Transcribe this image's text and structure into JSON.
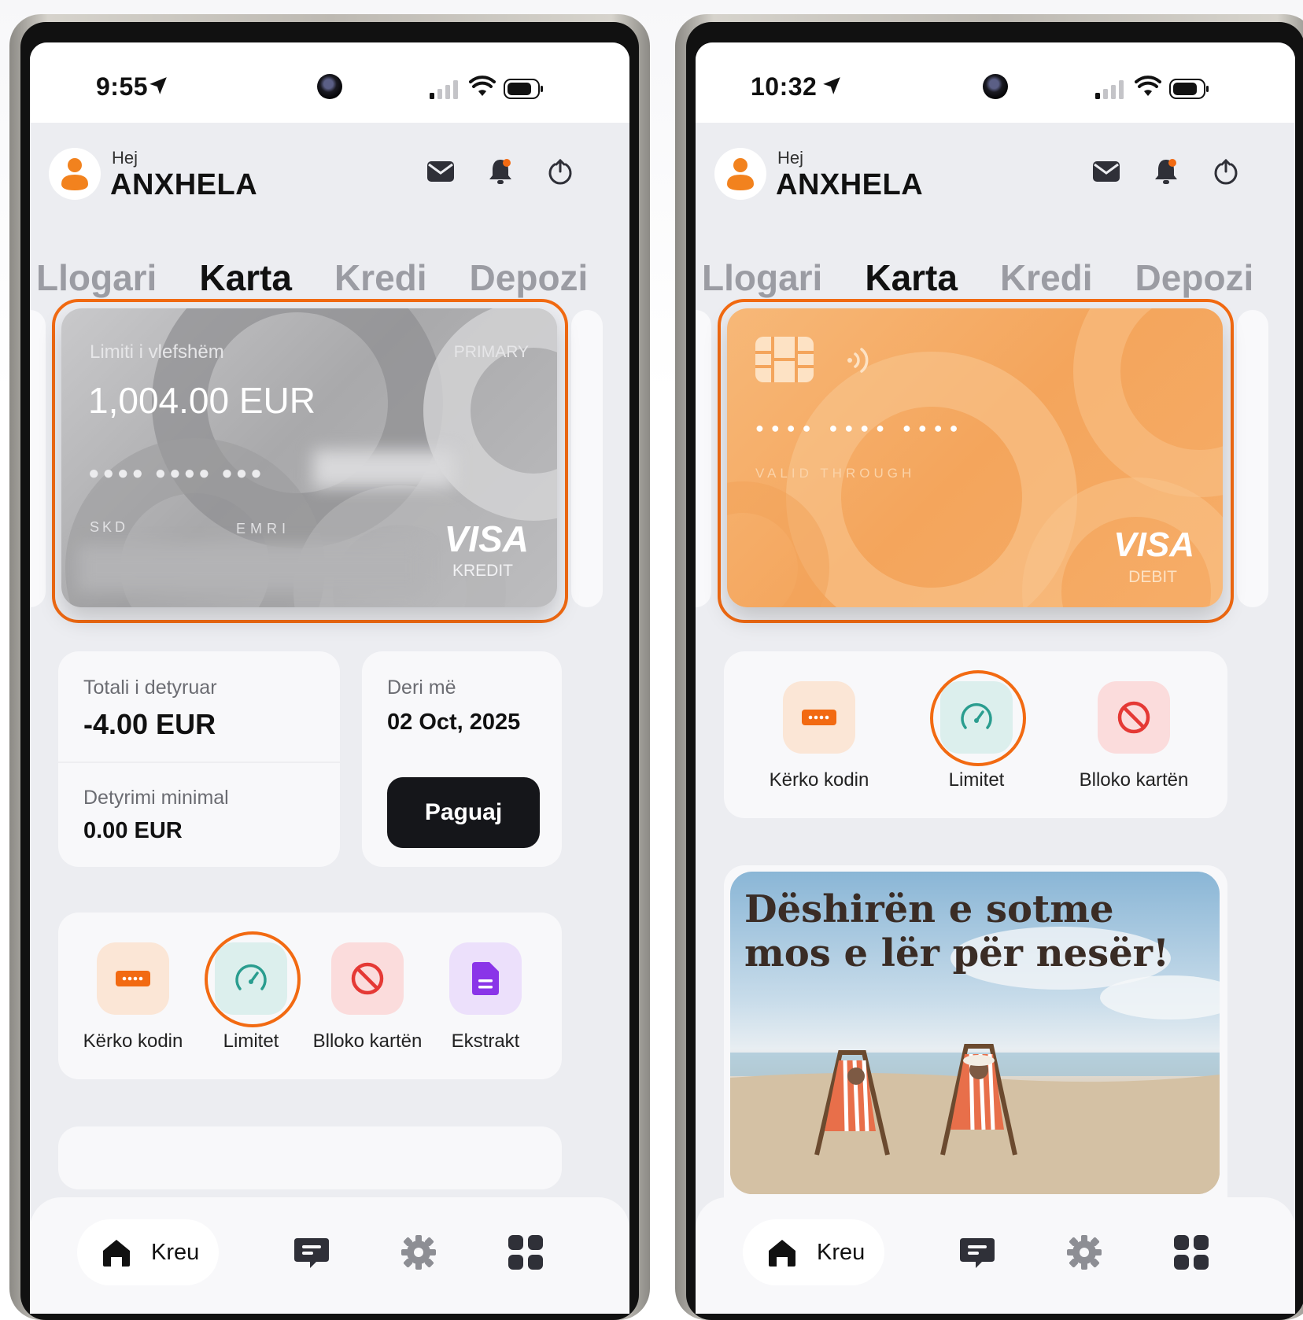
{
  "colors": {
    "accent": "#f26a12",
    "tab_active": "#111111",
    "tab_inactive": "#9b9ca3",
    "teal": "#2a9d8f",
    "red": "#e53935",
    "purple": "#8a35e8"
  },
  "left_phone": {
    "status": {
      "time": "9:55"
    },
    "header": {
      "greeting": "Hej",
      "name": "ANXHELA"
    },
    "tabs": [
      "Llogari",
      "Karta",
      "Kredi",
      "Depozi"
    ],
    "card": {
      "limit_label": "Limiti i vlefshëm",
      "primary_label": "PRIMARY",
      "amount": "1,004.00 EUR",
      "number_masked": "●●●● ●●●● ●●●",
      "expiry_label": "SKD",
      "name_label": "EMRI",
      "brand": "VISA",
      "type": "KREDIT"
    },
    "summary": {
      "total_label": "Totali i detyruar",
      "total_value": "-4.00 EUR",
      "minimum_label": "Detyrimi minimal",
      "minimum_value": "0.00 EUR",
      "due_label": "Deri më",
      "due_value": "02 Oct, 2025",
      "pay_button": "Paguaj"
    },
    "actions": [
      {
        "label": "Kërko kodin",
        "icon": "pin-code-icon"
      },
      {
        "label": "Limitet",
        "icon": "speedometer-icon"
      },
      {
        "label": "Blloko kartën",
        "icon": "block-icon"
      },
      {
        "label": "Ekstrakt",
        "icon": "document-icon"
      }
    ],
    "nav": {
      "home": "Kreu"
    }
  },
  "right_phone": {
    "status": {
      "time": "10:32"
    },
    "header": {
      "greeting": "Hej",
      "name": "ANXHELA"
    },
    "tabs": [
      "Llogari",
      "Karta",
      "Kredi",
      "Depozi"
    ],
    "card": {
      "number_masked": "●●●● ●●●● ●●●●",
      "valid_label": "VALID THROUGH",
      "brand": "VISA",
      "type": "DEBIT"
    },
    "actions": [
      {
        "label": "Kërko kodin",
        "icon": "pin-code-icon"
      },
      {
        "label": "Limitet",
        "icon": "speedometer-icon"
      },
      {
        "label": "Blloko kartën",
        "icon": "block-icon"
      }
    ],
    "promo": {
      "line1": "Dëshirën e sotme",
      "line2": "mos e lër për nesër!"
    },
    "nav": {
      "home": "Kreu"
    }
  }
}
